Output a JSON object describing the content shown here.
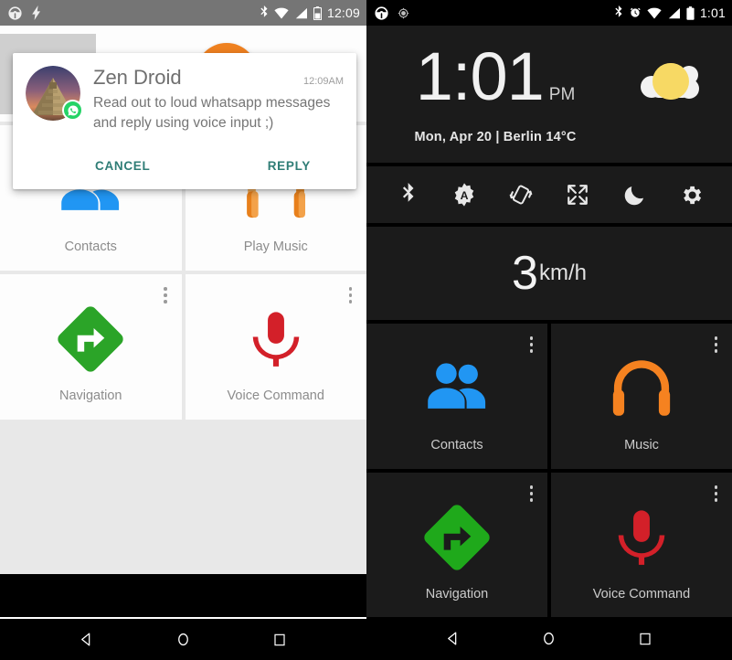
{
  "screens": {
    "left": {
      "theme": "light",
      "statusbar": {
        "icons": [
          "steering-wheel-icon",
          "flash-icon"
        ],
        "right_icons": [
          "bluetooth-icon",
          "wifi-icon",
          "signal-icon",
          "battery-icon"
        ],
        "time": "12:09"
      },
      "notification": {
        "app_name": "Zen Droid",
        "time": "12:09AM",
        "message": "Read out to loud whatsapp messages and reply using voice input ;)",
        "avatar_alt": "pyramid-photo",
        "badge": "whatsapp-icon",
        "cancel_label": "CANCEL",
        "reply_label": "REPLY",
        "action_color": "#2f7d76"
      },
      "media": {
        "album_art_icon": "headphones-placeholder-icon",
        "prev_label": "previous-track",
        "play_label": "play",
        "next_label": "next-track",
        "play_color": "#ef8120"
      },
      "tiles": [
        {
          "label": "Contacts",
          "icon": "contacts-icon",
          "color": "#2196f3"
        },
        {
          "label": "Play Music",
          "icon": "play-music-icon",
          "color": "#f0912d"
        },
        {
          "label": "Navigation",
          "icon": "navigation-icon",
          "color": "#2ba428"
        },
        {
          "label": "Voice Command",
          "icon": "microphone-icon",
          "color": "#d32029"
        }
      ]
    },
    "right": {
      "theme": "dark",
      "statusbar": {
        "icons": [
          "steering-wheel-icon",
          "gps-icon"
        ],
        "right_icons": [
          "bluetooth-icon",
          "alarm-icon",
          "wifi-icon",
          "signal-icon",
          "battery-icon"
        ],
        "time": "1:01"
      },
      "clock": {
        "time": "1:01",
        "ampm": "PM",
        "date_weather": "Mon, Apr 20 | Berlin 14°C",
        "weather_icon": "sun-behind-cloud-icon"
      },
      "toggles": [
        {
          "name": "bluetooth-toggle",
          "icon": "bluetooth-icon"
        },
        {
          "name": "auto-brightness-toggle",
          "icon": "brightness-auto-icon"
        },
        {
          "name": "auto-rotate-toggle",
          "icon": "screen-rotation-icon"
        },
        {
          "name": "fullscreen-toggle",
          "icon": "fullscreen-icon"
        },
        {
          "name": "night-mode-toggle",
          "icon": "moon-icon"
        },
        {
          "name": "settings-button",
          "icon": "gear-icon"
        }
      ],
      "speed": {
        "value": "3",
        "unit": "km/h"
      },
      "tiles": [
        {
          "label": "Contacts",
          "icon": "contacts-icon",
          "color": "#2196f3"
        },
        {
          "label": "Music",
          "icon": "headphones-icon",
          "color": "#f58220"
        },
        {
          "label": "Navigation",
          "icon": "navigation-icon",
          "color": "#1fa91b"
        },
        {
          "label": "Voice Command",
          "icon": "microphone-icon",
          "color": "#d32029"
        }
      ]
    }
  },
  "navbar": {
    "back": "back-button",
    "home": "home-button",
    "recents": "recents-button"
  }
}
